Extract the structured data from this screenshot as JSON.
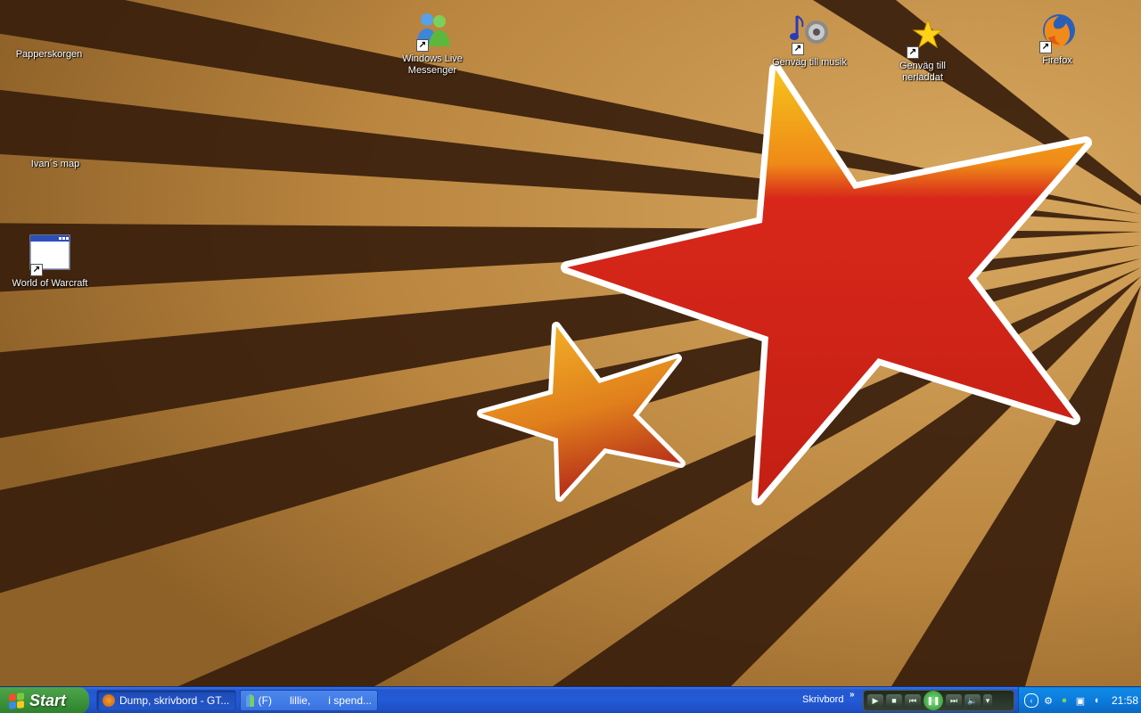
{
  "desktop": {
    "icons": [
      {
        "label": "Papperskorgen",
        "icon": "recycle-bin-icon"
      },
      {
        "label": "Ivan´s map",
        "icon": "folder-icon"
      },
      {
        "label": "World of Warcraft",
        "icon": "application-window-icon",
        "shortcut": true
      },
      {
        "label": "Windows Live Messenger",
        "icon": "messenger-icon",
        "shortcut": true
      },
      {
        "label": "Genväg till musik",
        "icon": "music-speaker-icon",
        "shortcut": true
      },
      {
        "label": "Genväg till nerladdat",
        "icon": "star-icon",
        "shortcut": true
      },
      {
        "label": "Firefox",
        "icon": "firefox-icon",
        "shortcut": true
      }
    ]
  },
  "taskbar": {
    "start_label": "Start",
    "buttons": [
      {
        "label": "Dump, skrivbord - GT...",
        "icon": "firefox-icon"
      },
      {
        "label": "(F)      lillie,      i spend...",
        "icon": "messenger-icon"
      }
    ],
    "toolbar_label": "Skrivbord",
    "toolbar_chevron": "»",
    "media_controls": [
      "stop-icon",
      "previous-icon",
      "pause-icon",
      "next-icon",
      "volume-icon"
    ],
    "tray_icons": [
      "collapse-arrow-icon",
      "network-icon",
      "messenger-tray-icon",
      "display-icon",
      "speaker-icon"
    ],
    "clock": "21:58"
  },
  "colors": {
    "taskbar_blue": "#235ad7",
    "start_green": "#3c943b",
    "tray_blue": "#0c7bdc",
    "wallpaper_light": "#c08e4a",
    "wallpaper_dark": "#3a1f0c",
    "star_red": "#d42a18",
    "star_orange": "#f0a020"
  }
}
